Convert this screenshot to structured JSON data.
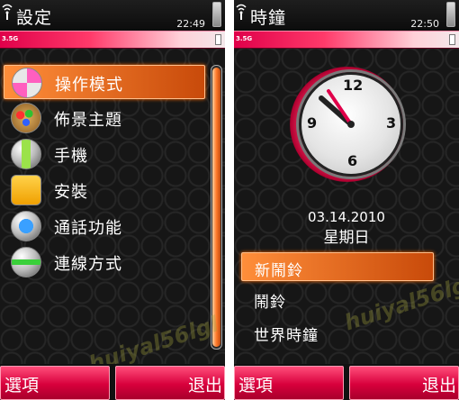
{
  "left_screen": {
    "title": "設定",
    "time": "22:49",
    "status_signal": "3.5G",
    "menu": [
      {
        "label": "操作模式",
        "icon": "mode-icon",
        "selected": true
      },
      {
        "label": "佈景主題",
        "icon": "theme-palette-icon",
        "selected": false
      },
      {
        "label": "手機",
        "icon": "phone-icon",
        "selected": false
      },
      {
        "label": "安裝",
        "icon": "folder-icon",
        "selected": false
      },
      {
        "label": "通話功能",
        "icon": "call-icon",
        "selected": false
      },
      {
        "label": "連線方式",
        "icon": "connectivity-icon",
        "selected": false
      }
    ],
    "softkeys": {
      "left": "選項",
      "right": "退出"
    }
  },
  "right_screen": {
    "title": "時鐘",
    "time": "22:50",
    "status_signal": "3.5G",
    "clock": {
      "numerals": [
        "12",
        "3",
        "6",
        "9"
      ]
    },
    "date": "03.14.2010",
    "weekday": "星期日",
    "menu": [
      {
        "label": "新鬧鈴",
        "selected": true
      },
      {
        "label": "鬧鈴",
        "selected": false
      },
      {
        "label": "世界時鐘",
        "selected": false
      }
    ],
    "softkeys": {
      "left": "選項",
      "right": "退出"
    }
  },
  "watermark": "huiyal56lgl",
  "colors": {
    "accent_orange": "#ff7a2a",
    "accent_pink": "#e0004a"
  }
}
